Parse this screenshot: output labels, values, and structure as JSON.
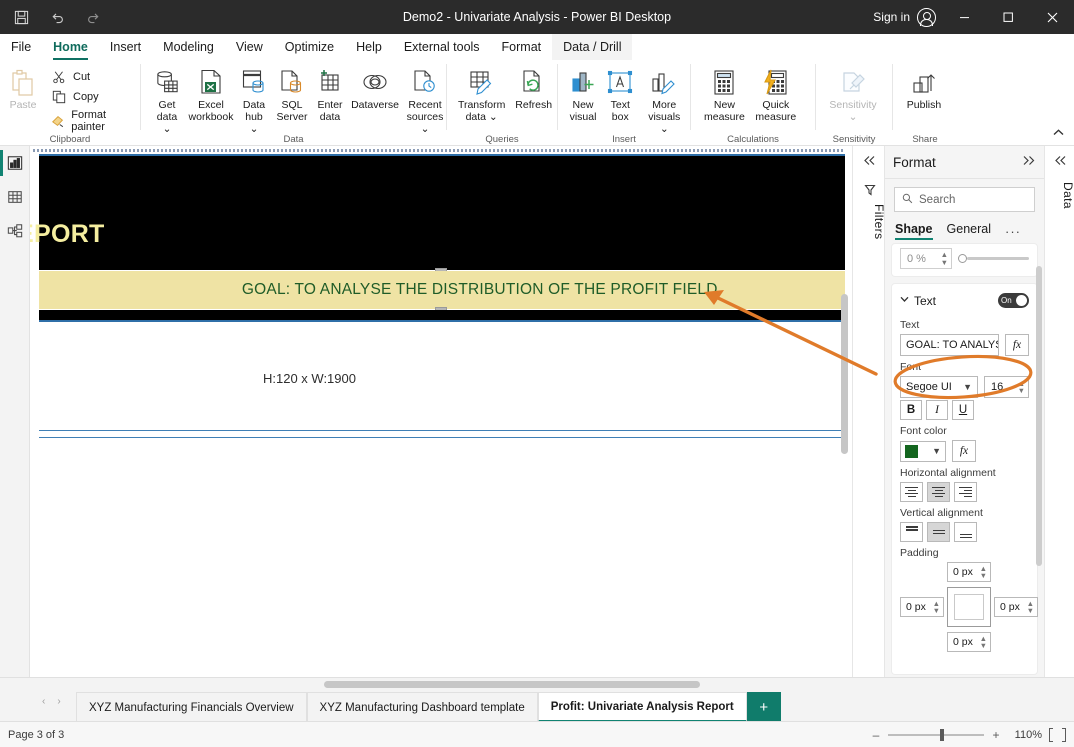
{
  "window": {
    "title": "Demo2 - Univariate Analysis - Power BI Desktop",
    "save_icon": "save-icon",
    "undo_icon": "undo-icon",
    "redo_icon": "redo-icon",
    "signin_label": "Sign in",
    "minimize_label": "—",
    "maximize_label": "☐",
    "close_label": "✕"
  },
  "ribbon": {
    "tabs": [
      {
        "label": "File",
        "state": "normal"
      },
      {
        "label": "Home",
        "state": "active"
      },
      {
        "label": "Insert",
        "state": "normal"
      },
      {
        "label": "Modeling",
        "state": "normal"
      },
      {
        "label": "View",
        "state": "normal"
      },
      {
        "label": "Optimize",
        "state": "normal"
      },
      {
        "label": "Help",
        "state": "normal"
      },
      {
        "label": "External tools",
        "state": "normal"
      },
      {
        "label": "Format",
        "state": "normal"
      },
      {
        "label": "Data / Drill",
        "state": "highlight"
      }
    ],
    "collapse_icon": "chevron-up-icon",
    "groups": [
      {
        "name": "Clipboard",
        "label": "Clipboard",
        "big": [
          {
            "label": "Paste",
            "icon": "paste-icon",
            "disabled": true
          }
        ],
        "small": [
          {
            "label": "Cut",
            "icon": "scissors-icon"
          },
          {
            "label": "Copy",
            "icon": "copy-icon"
          },
          {
            "label": "Format painter",
            "icon": "format-painter-icon"
          }
        ]
      },
      {
        "name": "Data",
        "label": "Data",
        "big": [
          {
            "label": "Get\ndata ⌄",
            "icon": "get-data-icon"
          },
          {
            "label": "Excel\nworkbook",
            "icon": "excel-workbook-icon"
          },
          {
            "label": "Data\nhub ⌄",
            "icon": "data-hub-icon"
          },
          {
            "label": "SQL\nServer",
            "icon": "sql-server-icon"
          },
          {
            "label": "Enter\ndata",
            "icon": "enter-data-icon"
          },
          {
            "label": "Dataverse",
            "icon": "dataverse-icon"
          },
          {
            "label": "Recent\nsources ⌄",
            "icon": "recent-sources-icon"
          }
        ]
      },
      {
        "name": "Queries",
        "label": "Queries",
        "big": [
          {
            "label": "Transform\ndata ⌄",
            "icon": "transform-data-icon"
          },
          {
            "label": "Refresh",
            "icon": "refresh-icon"
          }
        ]
      },
      {
        "name": "Insert",
        "label": "Insert",
        "big": [
          {
            "label": "New\nvisual",
            "icon": "new-visual-icon"
          },
          {
            "label": "Text\nbox",
            "icon": "text-box-icon"
          },
          {
            "label": "More\nvisuals ⌄",
            "icon": "more-visuals-icon"
          }
        ]
      },
      {
        "name": "Calculations",
        "label": "Calculations",
        "big": [
          {
            "label": "New\nmeasure",
            "icon": "new-measure-icon"
          },
          {
            "label": "Quick\nmeasure",
            "icon": "quick-measure-icon"
          }
        ]
      },
      {
        "name": "Sensitivity",
        "label": "Sensitivity",
        "big": [
          {
            "label": "Sensitivity\n⌄",
            "icon": "sensitivity-icon",
            "disabled": true
          }
        ]
      },
      {
        "name": "Share",
        "label": "Share",
        "big": [
          {
            "label": "Publish",
            "icon": "publish-icon"
          }
        ]
      }
    ]
  },
  "left_rail": {
    "items": [
      {
        "icon": "report-view-icon",
        "name": "report-view",
        "active": true
      },
      {
        "icon": "table-view-icon",
        "name": "table-view",
        "active": false
      },
      {
        "icon": "model-view-icon",
        "name": "model-view",
        "active": false
      }
    ]
  },
  "canvas": {
    "report_title": "EPORT",
    "goal_text": "GOAL: TO ANALYSE THE DISTRIBUTION OF THE PROFIT FIELD.",
    "dimension_label": "H:120 x W:1900",
    "colors": {
      "banner_bg": "#efe3a4",
      "banner_text": "#1f5c28",
      "header_bg": "#000000",
      "title_text": "#f5eea0",
      "rule_blue": "#2f6fa8"
    }
  },
  "filters_pane": {
    "collapse_icon": "chevron-left-icon",
    "filter_icon": "filter-icon",
    "label": "Filters"
  },
  "format_pane": {
    "title": "Format",
    "expand_icon": "chevron-double-right-icon",
    "search": {
      "placeholder": "Search",
      "icon": "search-icon",
      "value": ""
    },
    "tabs": [
      {
        "label": "Shape",
        "active": true
      },
      {
        "label": "General",
        "active": false
      }
    ],
    "more_label": "···",
    "transparency": {
      "value": "0 %",
      "slider_pct": 0
    },
    "text_section": {
      "title": "Text",
      "chevron": "chevron-down-icon",
      "toggle_label": "On",
      "toggle_on": true,
      "text_label": "Text",
      "text_value": "GOAL: TO ANALYSE",
      "fx_label": "fx",
      "font_label": "Font",
      "font_family": "Segoe UI",
      "font_size": "16",
      "bold_label": "B",
      "italic_label": "I",
      "underline_label": "U",
      "font_color_label": "Font color",
      "font_color": "#14661f",
      "horizontal_alignment_label": "Horizontal alignment",
      "horizontal_alignment_selected": 1,
      "vertical_alignment_label": "Vertical alignment",
      "vertical_alignment_selected": 1,
      "padding_label": "Padding",
      "padding_top": "0 px",
      "padding_left": "0 px",
      "padding_right": "0 px",
      "padding_bottom": "0 px"
    }
  },
  "data_pane": {
    "collapse_icon": "chevron-double-left-icon",
    "label": "Data"
  },
  "page_tabs": {
    "prev_icon": "‹",
    "next_icon": "›",
    "tabs": [
      {
        "label": "XYZ Manufacturing Financials Overview",
        "active": false
      },
      {
        "label": "XYZ Manufacturing Dashboard template",
        "active": false
      },
      {
        "label": "Profit: Univariate Analysis Report",
        "active": true
      }
    ],
    "add_label": "+"
  },
  "status_bar": {
    "page_status": "Page 3 of 3",
    "zoom_minus": "–",
    "zoom_plus": "+",
    "zoom_level": "110%",
    "fit_icon": "fit-to-page-icon"
  },
  "annotations": {
    "arrow_color": "#e07b2a",
    "ellipse_color": "#e07b2a"
  }
}
